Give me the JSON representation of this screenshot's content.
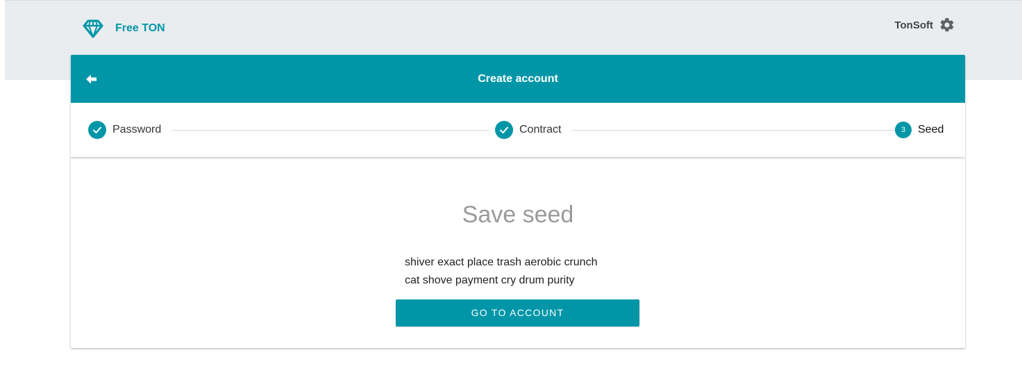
{
  "app": {
    "brand_name": "Free TON",
    "user_name": "TonSoft"
  },
  "card": {
    "title": "Create account"
  },
  "stepper": {
    "steps": [
      {
        "label": "Password",
        "state": "completed",
        "icon": "check-icon"
      },
      {
        "label": "Contract",
        "state": "completed",
        "icon": "check-icon"
      },
      {
        "label": "Seed",
        "state": "active",
        "number": "3"
      }
    ]
  },
  "content": {
    "heading": "Save seed",
    "seed_lines": [
      "shiver exact place trash aerobic crunch",
      "cat shove payment cry drum purity"
    ],
    "button_label": "GO TO ACCOUNT"
  },
  "colors": {
    "accent": "#0096a7",
    "top_band": "#eaedf0",
    "heading_gray": "#9a9a9a"
  }
}
